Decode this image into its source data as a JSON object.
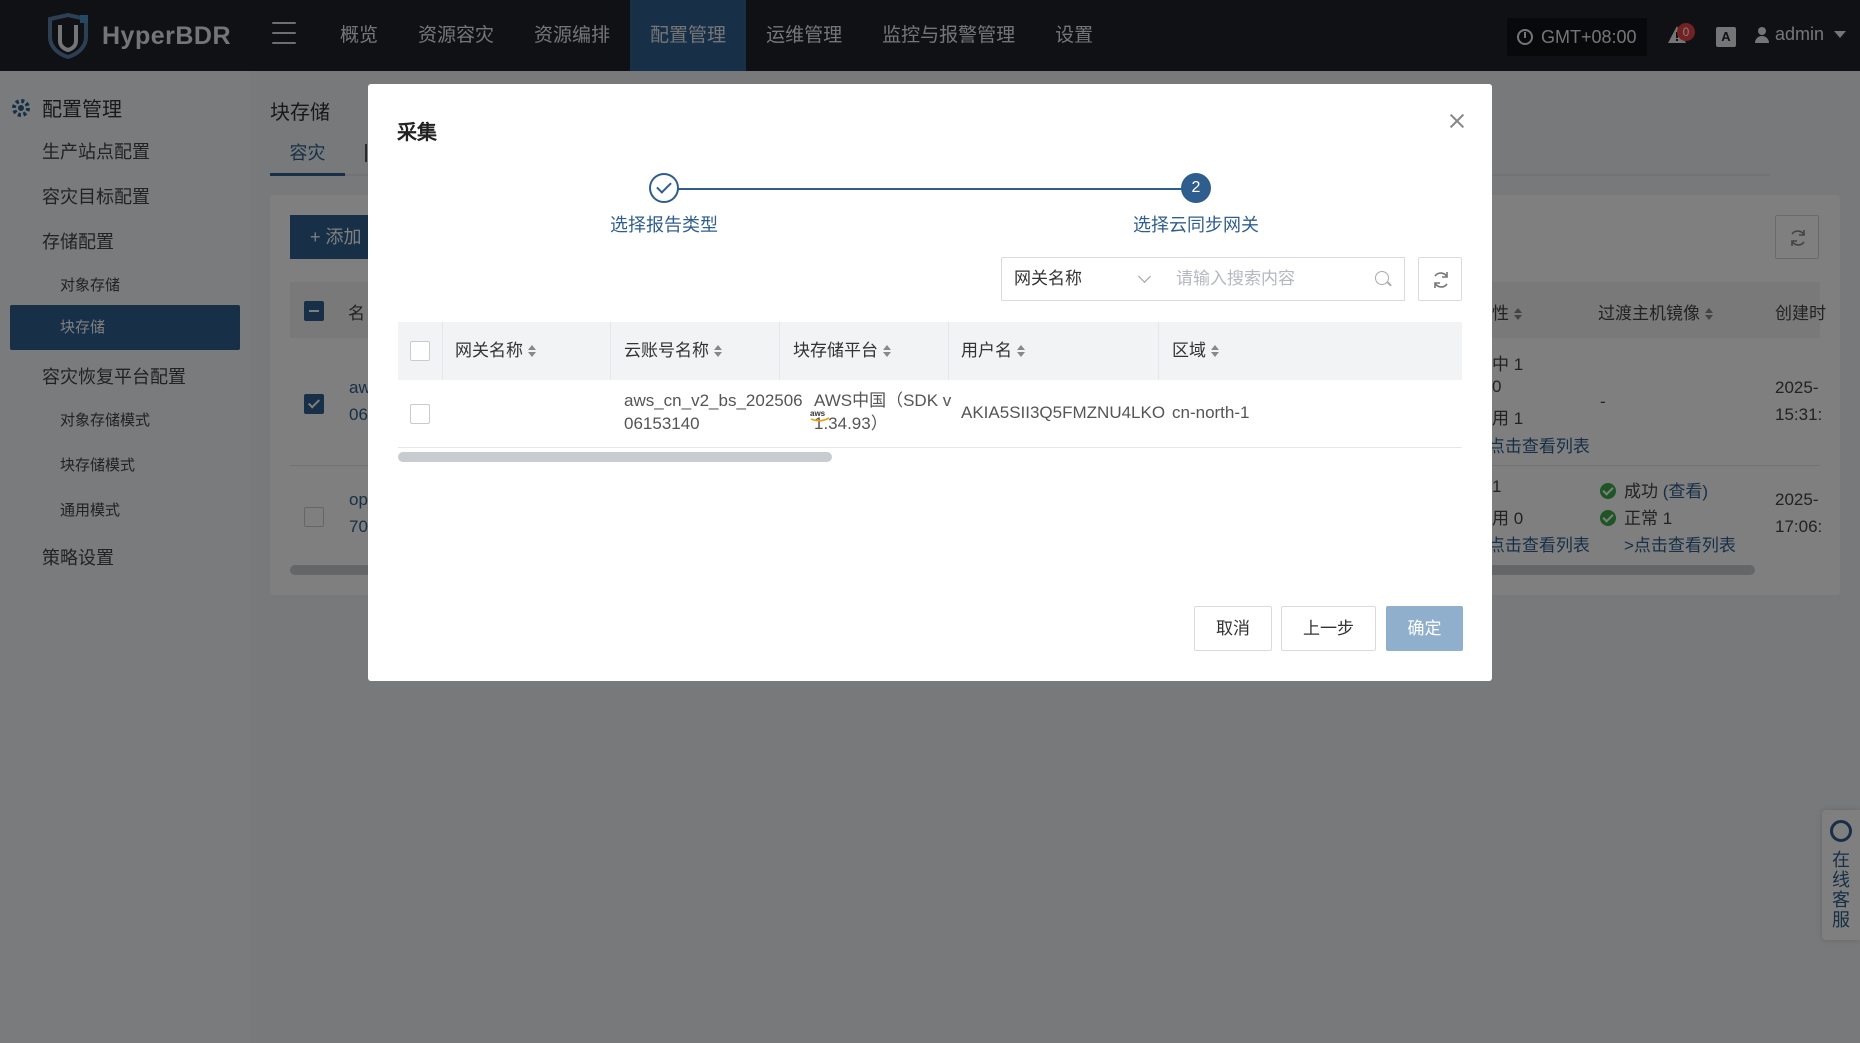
{
  "app": {
    "name": "HyperBDR"
  },
  "topnav": {
    "items": [
      {
        "label": "概览",
        "active": false
      },
      {
        "label": "资源容灾",
        "active": false
      },
      {
        "label": "资源编排",
        "active": false
      },
      {
        "label": "配置管理",
        "active": true
      },
      {
        "label": "运维管理",
        "active": false
      },
      {
        "label": "监控与报警管理",
        "active": false
      },
      {
        "label": "设置",
        "active": false
      }
    ],
    "timezone": "GMT+08:00",
    "alarm_count": "0",
    "lang_icon_text": "A",
    "username": "admin"
  },
  "sidebar": {
    "title": "配置管理",
    "items": {
      "production_site": "生产站点配置",
      "dr_target": "容灾目标配置",
      "storage_config": "存储配置",
      "object_storage": "对象存储",
      "block_storage": "块存储",
      "dr_platform": "容灾恢复平台配置",
      "object_storage_mode": "对象存储模式",
      "block_storage_mode": "块存储模式",
      "general_mode": "通用模式",
      "policy": "策略设置"
    }
  },
  "main": {
    "title": "块存储",
    "tab_active": "容灾",
    "add_label": "+ 添加",
    "head_partial_name": "名",
    "head_attr": "性",
    "head_transition_image": "过渡主机镜像",
    "head_created": "创建时",
    "rows": [
      {
        "name_line1": "aw",
        "name_line2": "06",
        "attr_lines": [
          "中 1",
          "0",
          "用 1"
        ],
        "attr_link": ">点击查看列表",
        "image": "-",
        "created_line1": "2025-",
        "created_line2": "15:31:"
      },
      {
        "name_line1": "op",
        "name_line2": "70",
        "attr_lines": [
          "1",
          "用 0"
        ],
        "attr_link": ">点击查看列表",
        "image_status": "成功",
        "image_view": "(查看)",
        "image_normal": "正常 1",
        "image_link": ">点击查看列表",
        "created_line1": "2025-",
        "created_line2": "17:06:"
      }
    ]
  },
  "chat": {
    "label": "在线客服"
  },
  "modal": {
    "title": "采集",
    "steps": [
      {
        "label": "选择报告类型",
        "state": "done"
      },
      {
        "label": "选择云同步网关",
        "number": "2",
        "state": "active"
      }
    ],
    "filter": {
      "field": "网关名称",
      "placeholder": "请输入搜索内容"
    },
    "table": {
      "columns": [
        "网关名称",
        "云账号名称",
        "块存储平台",
        "用户名",
        "区域"
      ],
      "rows": [
        {
          "gateway": "",
          "account_line1": "aws_cn_v2_bs_202506",
          "account_line2": "06153140",
          "platform_line1": "AWS中国（SDK v",
          "platform_line2": "1.34.93）",
          "username": "AKIA5SII3Q5FMZNU4LKO",
          "region": "cn-north-1"
        }
      ]
    },
    "buttons": {
      "cancel": "取消",
      "prev": "上一步",
      "confirm": "确定"
    }
  }
}
